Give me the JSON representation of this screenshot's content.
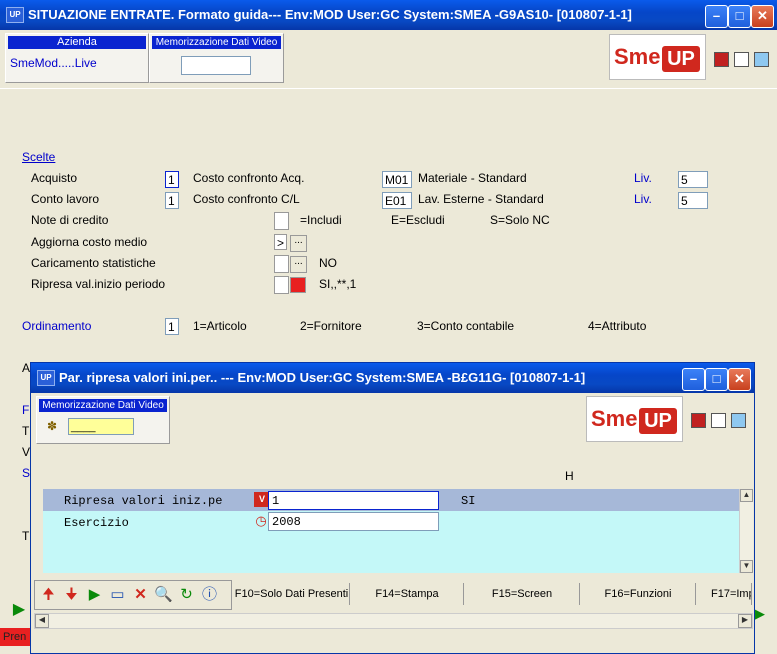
{
  "main_window": {
    "title": "SITUAZIONE ENTRATE.  Formato guida--- Env:MOD User:GC System:SMEA -G9AS10- [010807-1-1]",
    "icon_label": "UP",
    "azienda_label": "Azienda",
    "azienda_value": "SmeMod.....Live",
    "memorizzazione_label": "Memorizzazione Dati Video",
    "memorizzazione_value": "",
    "logo_left": "Sme.",
    "logo_right": "UP",
    "scelte_link": "Scelte",
    "rows": {
      "acquisto": {
        "label": "Acquisto",
        "value": "1",
        "desc": "Costo confronto Acq.",
        "code": "M01",
        "code_desc": "Materiale - Standard",
        "liv_label": "Liv.",
        "liv_value": "5"
      },
      "conto_lavoro": {
        "label": "Conto lavoro",
        "value": "1",
        "desc": "Costo confronto C/L",
        "code": "E01",
        "code_desc": "Lav. Esterne - Standard",
        "liv_label": "Liv.",
        "liv_value": "5"
      },
      "note_credito": {
        "label": "Note di credito",
        "opt1": "=Includi",
        "opt2": "E=Escludi",
        "opt3": "S=Solo NC"
      },
      "aggiorna": {
        "label": "Aggiorna costo medio",
        "value": ">"
      },
      "caricamento": {
        "label": "Caricamento statistiche",
        "text": "NO"
      },
      "ripresa": {
        "label": "Ripresa val.inizio periodo",
        "text": "SI,,**,1"
      }
    },
    "ordinamento": {
      "label": "Ordinamento",
      "value": "1",
      "opt1": "1=Articolo",
      "opt2": "2=Fornitore",
      "opt3": "3=Conto contabile",
      "opt4": "4=Attributo"
    },
    "hidden_letters": [
      "A",
      "F",
      "T",
      "V",
      "S",
      "T"
    ],
    "status_left": "Pren"
  },
  "dialog": {
    "title": "Par. ripresa valori ini.per.. --- Env:MOD User:GC System:SMEA -B£G11G- [010807-1-1]",
    "icon_label": "UP",
    "memorizzazione_label": "Memorizzazione Dati Video",
    "memorizzazione_value": "____",
    "logo_left": "Sme.",
    "logo_right": "UP",
    "column_header": "H",
    "rows": [
      {
        "label": "Ripresa valori iniz.pe",
        "value": "1",
        "extra": "SI"
      },
      {
        "label": "Esercizio",
        "value": "2008",
        "extra": ""
      }
    ],
    "function_keys": [
      "F10=Solo Dati Presenti",
      "F14=Stampa",
      "F15=Screen",
      "F16=Funzioni",
      "F17=Imp"
    ]
  },
  "colors": {
    "accent": "#0A24D0",
    "title_bar": "#0646C8",
    "grid_bg": "#C4F8F8",
    "grid_selected": "#A6B8D8",
    "logo_red": "#D0281E"
  }
}
